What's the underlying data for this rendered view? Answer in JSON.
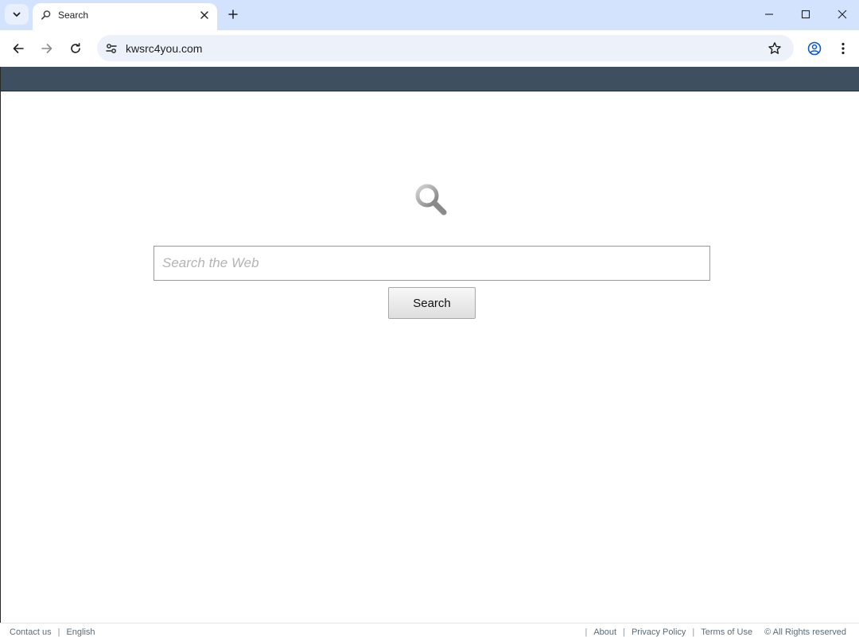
{
  "browser": {
    "tab": {
      "title": "Search"
    },
    "url": "kwsrc4you.com"
  },
  "page": {
    "search": {
      "placeholder": "Search the Web",
      "value": "",
      "button_label": "Search"
    },
    "footer": {
      "left_links": [
        "Contact us",
        "English"
      ],
      "right_links": [
        "About",
        "Privacy Policy",
        "Terms of Use"
      ],
      "copyright": "© All Rights reserved"
    }
  },
  "colors": {
    "tabstrip": "#d3e3fd",
    "header_bar": "#3e5060",
    "omnibox": "#edf2fa"
  }
}
